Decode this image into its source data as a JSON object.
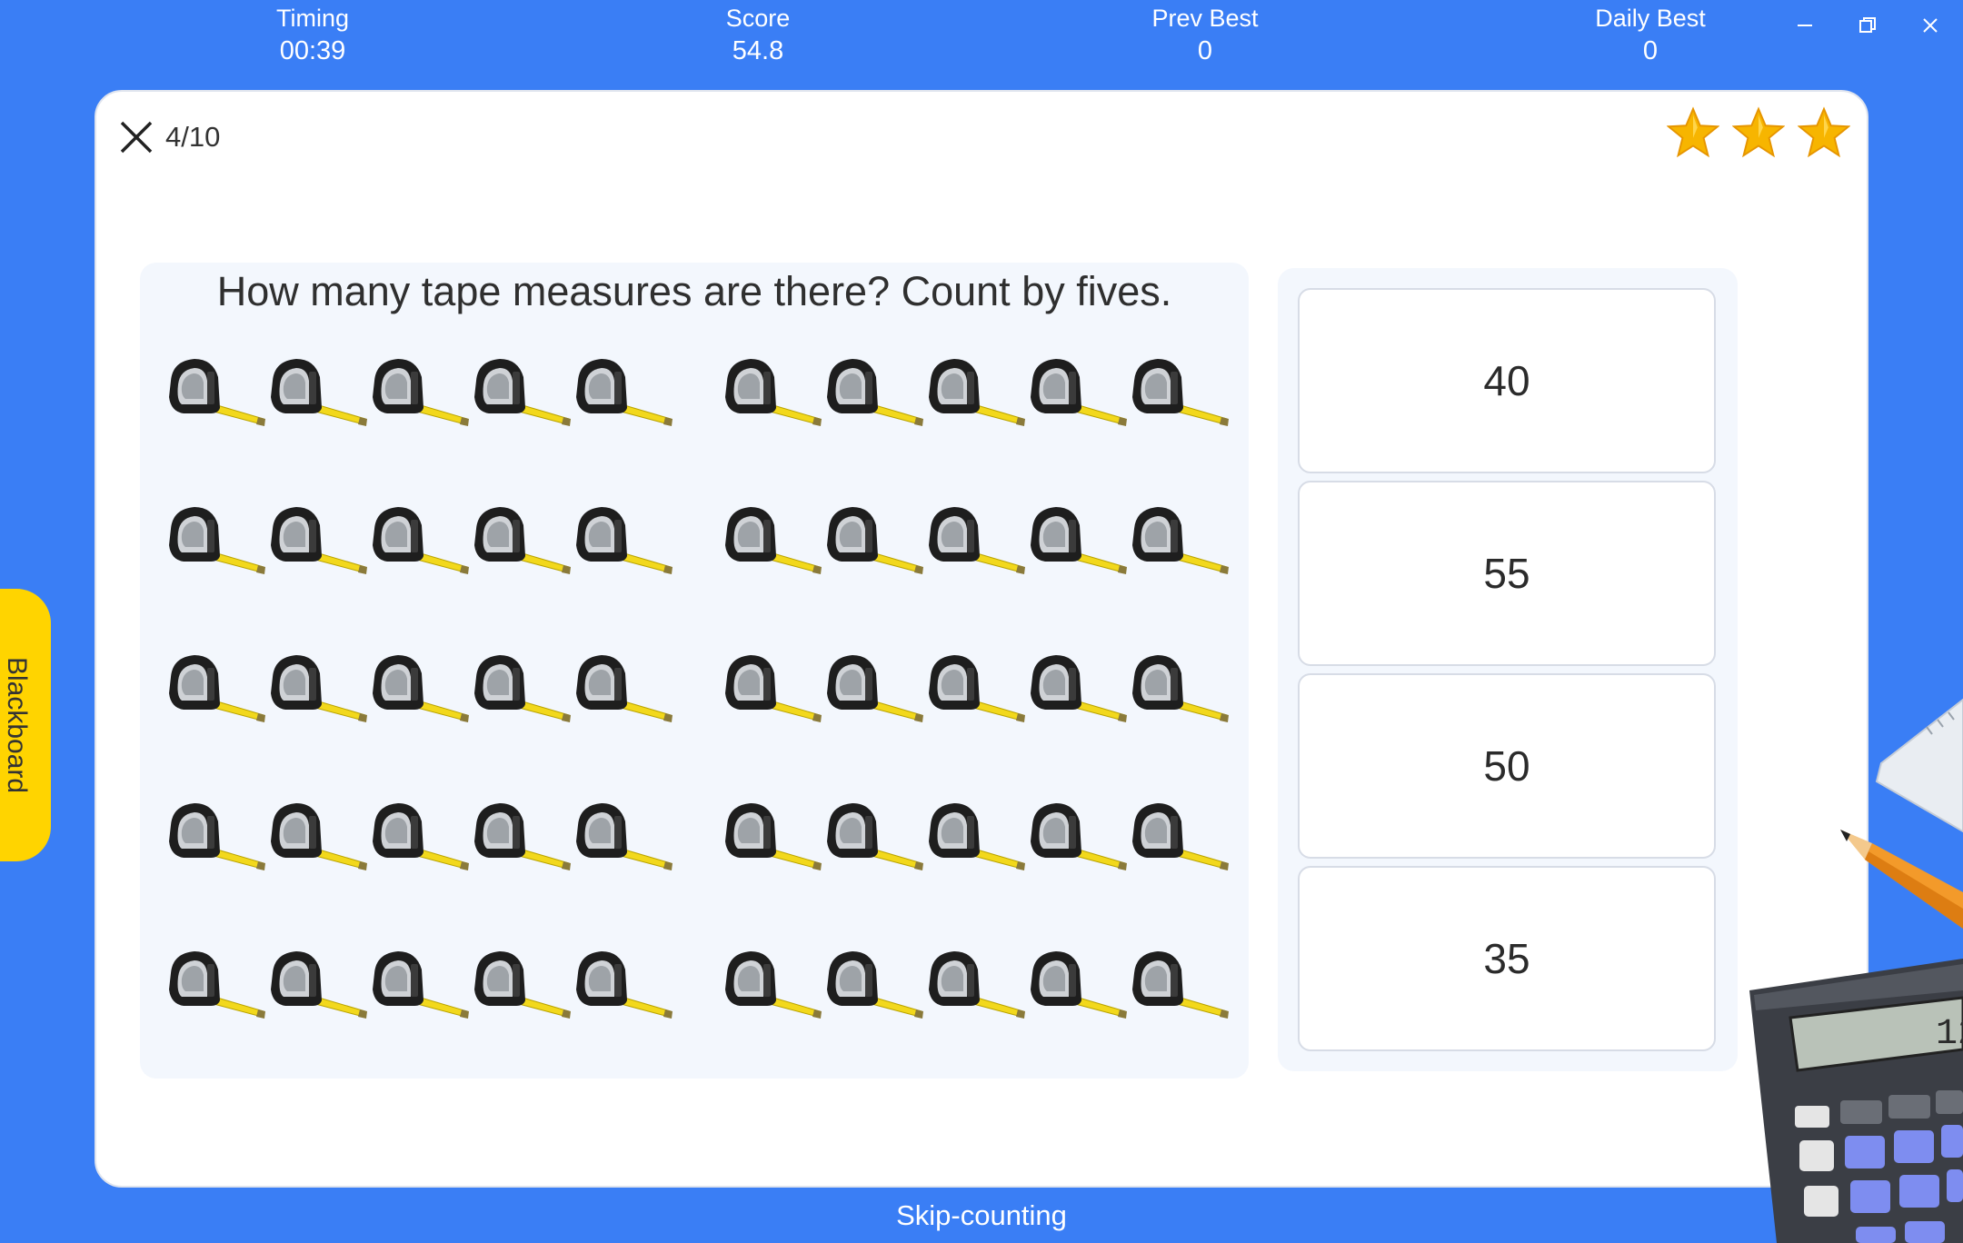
{
  "stats": [
    {
      "label": "Timing",
      "value": "00:39"
    },
    {
      "label": "Score",
      "value": "54.8"
    },
    {
      "label": "Prev Best",
      "value": "0"
    },
    {
      "label": "Daily Best",
      "value": "0"
    }
  ],
  "window_controls": {
    "minimize": "minimize-icon",
    "restore": "restore-icon",
    "close": "close-icon"
  },
  "quiz": {
    "progress": "4/10",
    "stars_earned": 3,
    "question": "How many tape measures are there? Count by fives.",
    "tape_measure_rows": 5,
    "groups_per_row": 2,
    "items_per_group": 5,
    "answers": [
      "40",
      "55",
      "50",
      "35"
    ]
  },
  "side_tab": {
    "label": "Blackboard"
  },
  "footer": {
    "topic": "Skip-counting"
  },
  "colors": {
    "background": "#3a7ef5",
    "star": "#f7b500",
    "tab": "#ffd400",
    "tape": "#f2d81c"
  }
}
